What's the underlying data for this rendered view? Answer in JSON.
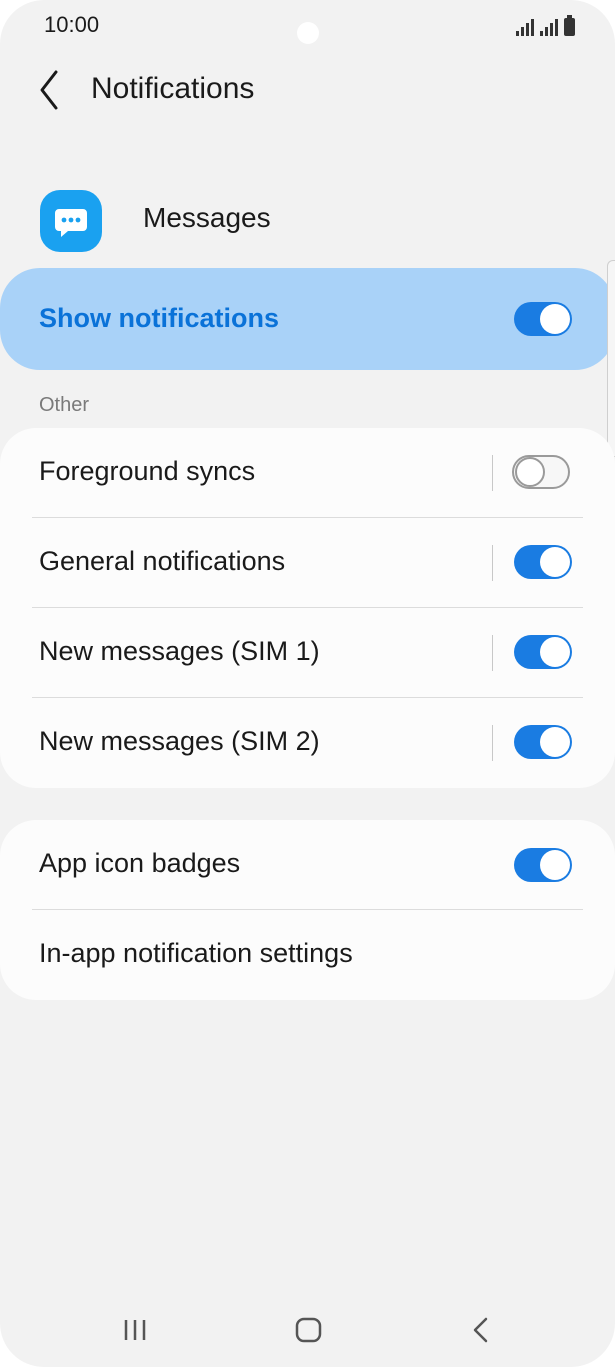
{
  "status_bar": {
    "time": "10:00"
  },
  "header": {
    "back_icon": "chevron-left-icon",
    "title": "Notifications"
  },
  "app": {
    "name": "Messages",
    "icon": "chat-bubble-icon",
    "icon_color": "#1aa1f0"
  },
  "master_switch": {
    "label": "Show notifications",
    "on": true
  },
  "other_section": {
    "header": "Other",
    "items": [
      {
        "label": "Foreground syncs",
        "on": false
      },
      {
        "label": "General notifications",
        "on": true
      },
      {
        "label": "New messages (SIM 1)",
        "on": true
      },
      {
        "label": "New messages (SIM 2)",
        "on": true
      }
    ]
  },
  "extra_section": {
    "items": [
      {
        "label": "App icon badges",
        "on": true
      },
      {
        "label": "In-app notification settings"
      }
    ]
  },
  "colors": {
    "accent": "#1a7ce2",
    "master_bg": "#a9d2f8",
    "master_text": "#0a72d8",
    "background": "#f2f2f2",
    "card": "#fcfcfc"
  },
  "navbar": {
    "recents_icon": "recents-icon",
    "home_icon": "home-icon",
    "back_icon": "back-icon"
  }
}
